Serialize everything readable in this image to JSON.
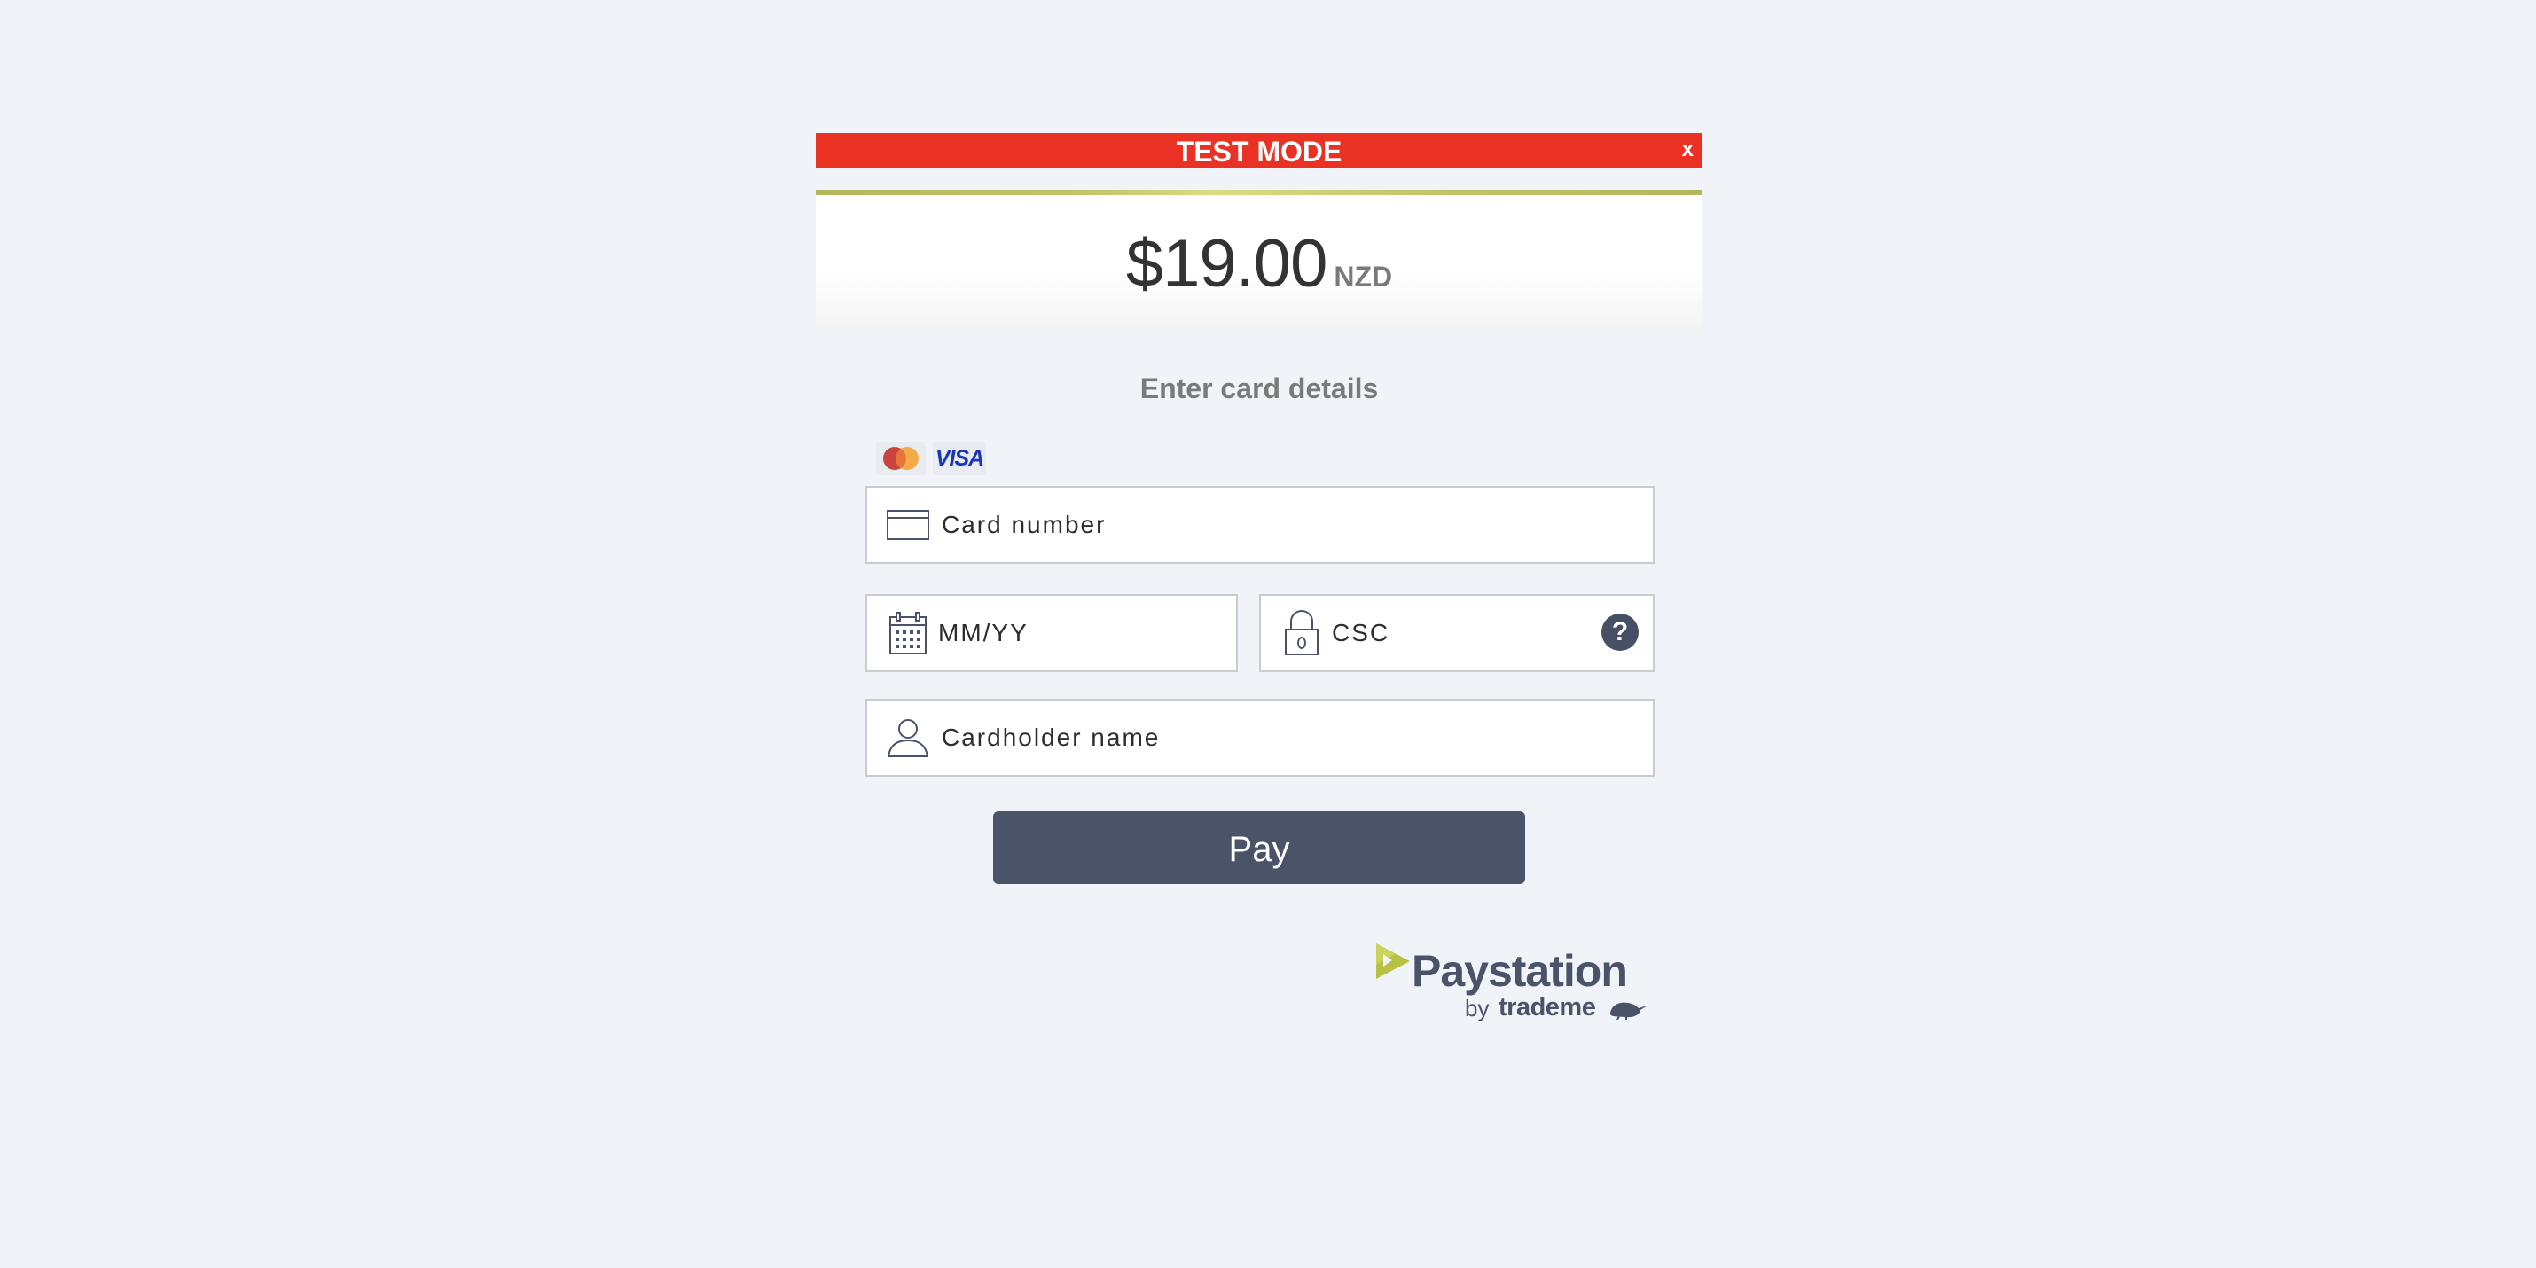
{
  "banner": {
    "title": "TEST MODE",
    "close_label": "x",
    "color": "#ea3224"
  },
  "payment": {
    "amount": "$19.00",
    "currency": "NZD"
  },
  "form": {
    "title": "Enter card details",
    "accepted_cards": [
      "mastercard-icon",
      "visa-icon"
    ],
    "visa_label": "VISA",
    "card_number_placeholder": "Card number",
    "expiry_placeholder": "MM/YY",
    "csc_placeholder": "CSC",
    "csc_help_label": "?",
    "cardholder_placeholder": "Cardholder name",
    "pay_label": "Pay",
    "pay_button_color": "#4a5368"
  },
  "footer": {
    "brand_name": "Paystation",
    "brand_by": "by",
    "brand_owner": "trademe",
    "brand_color": "#4a5368",
    "accent_color": "#b8c242"
  }
}
